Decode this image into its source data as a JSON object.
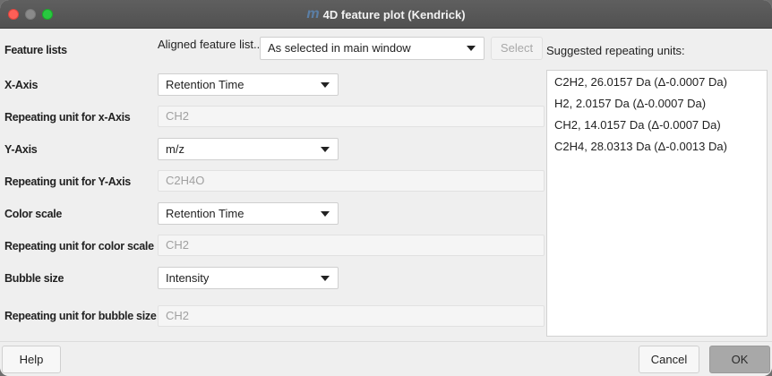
{
  "window": {
    "title": "4D feature plot (Kendrick)",
    "logo_text": "m"
  },
  "feature_lists": {
    "label": "Feature lists",
    "sub_label": "Aligned feature list...",
    "selected": "As selected in main window",
    "select_button": "Select"
  },
  "x_axis": {
    "label": "X-Axis",
    "value": "Retention Time"
  },
  "x_unit": {
    "label": "Repeating unit for x-Axis",
    "value": "CH2"
  },
  "y_axis": {
    "label": "Y-Axis",
    "value": "m/z"
  },
  "y_unit": {
    "label": "Repeating unit for Y-Axis",
    "value": "C2H4O"
  },
  "color_scale": {
    "label": "Color scale",
    "value": "Retention Time"
  },
  "color_unit": {
    "label": "Repeating unit for color scale",
    "value": "CH2"
  },
  "bubble_size": {
    "label": "Bubble size",
    "value": "Intensity"
  },
  "bubble_unit": {
    "label": "Repeating unit for bubble size",
    "value": "CH2"
  },
  "suggestions": {
    "label": "Suggested repeating units:",
    "items": [
      "C2H2, 26.0157 Da (Δ-0.0007 Da)",
      "H2, 2.0157 Da (Δ-0.0007 Da)",
      "CH2, 14.0157 Da (Δ-0.0007 Da)",
      "C2H4, 28.0313 Da (Δ-0.0013 Da)"
    ]
  },
  "footer": {
    "help": "Help",
    "cancel": "Cancel",
    "ok": "OK"
  },
  "colors": {
    "titlebar": "#555555",
    "close": "#fe5f57",
    "maximize": "#28c840",
    "ok_button": "#a8a8a8"
  }
}
